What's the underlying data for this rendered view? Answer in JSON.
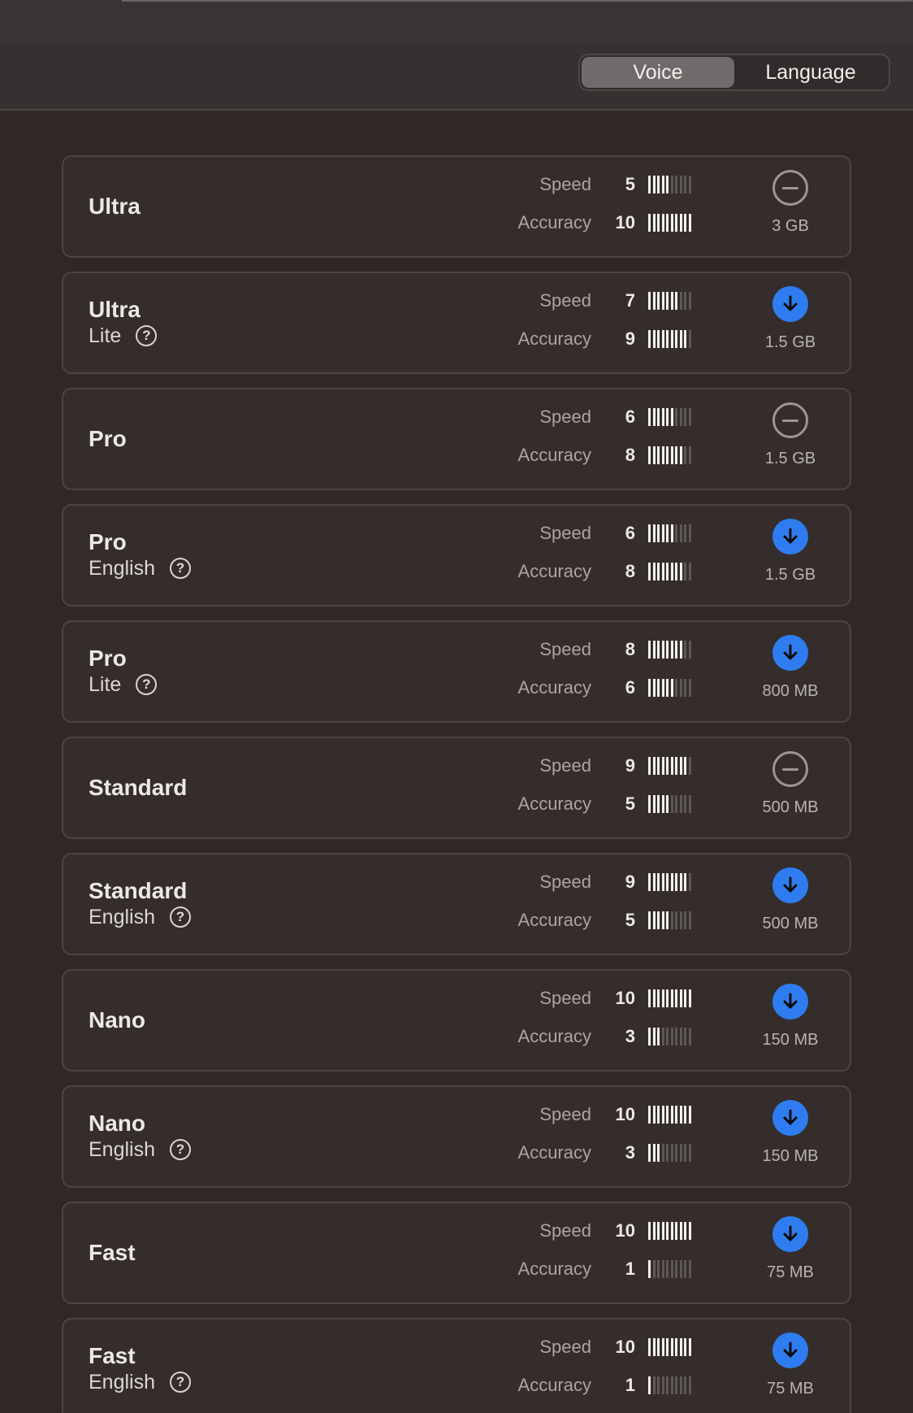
{
  "tabs": [
    {
      "label": "Voice",
      "active": true
    },
    {
      "label": "Language",
      "active": false
    }
  ],
  "labels": {
    "speed": "Speed",
    "accuracy": "Accuracy"
  },
  "colors": {
    "accent": "#2f7cf0",
    "bar_on": "#f4f0ee",
    "bar_off": "#5d5756"
  },
  "models": [
    {
      "title": "Ultra",
      "subtitle": "",
      "speed": 5,
      "accuracy": 10,
      "action": "remove",
      "action_icon": "minus-circle-icon",
      "size": "3 GB"
    },
    {
      "title": "Ultra",
      "subtitle": "Lite",
      "speed": 7,
      "accuracy": 9,
      "action": "download",
      "action_icon": "download-icon",
      "size": "1.5 GB"
    },
    {
      "title": "Pro",
      "subtitle": "",
      "speed": 6,
      "accuracy": 8,
      "action": "remove",
      "action_icon": "minus-circle-icon",
      "size": "1.5 GB"
    },
    {
      "title": "Pro",
      "subtitle": "English",
      "speed": 6,
      "accuracy": 8,
      "action": "download",
      "action_icon": "download-icon",
      "size": "1.5 GB"
    },
    {
      "title": "Pro",
      "subtitle": "Lite",
      "speed": 8,
      "accuracy": 6,
      "action": "download",
      "action_icon": "download-icon",
      "size": "800 MB"
    },
    {
      "title": "Standard",
      "subtitle": "",
      "speed": 9,
      "accuracy": 5,
      "action": "remove",
      "action_icon": "minus-circle-icon",
      "size": "500 MB"
    },
    {
      "title": "Standard",
      "subtitle": "English",
      "speed": 9,
      "accuracy": 5,
      "action": "download",
      "action_icon": "download-icon",
      "size": "500 MB"
    },
    {
      "title": "Nano",
      "subtitle": "",
      "speed": 10,
      "accuracy": 3,
      "action": "download",
      "action_icon": "download-icon",
      "size": "150 MB"
    },
    {
      "title": "Nano",
      "subtitle": "English",
      "speed": 10,
      "accuracy": 3,
      "action": "download",
      "action_icon": "download-icon",
      "size": "150 MB"
    },
    {
      "title": "Fast",
      "subtitle": "",
      "speed": 10,
      "accuracy": 1,
      "action": "download",
      "action_icon": "download-icon",
      "size": "75 MB"
    },
    {
      "title": "Fast",
      "subtitle": "English",
      "speed": 10,
      "accuracy": 1,
      "action": "download",
      "action_icon": "download-icon",
      "size": "75 MB"
    }
  ]
}
